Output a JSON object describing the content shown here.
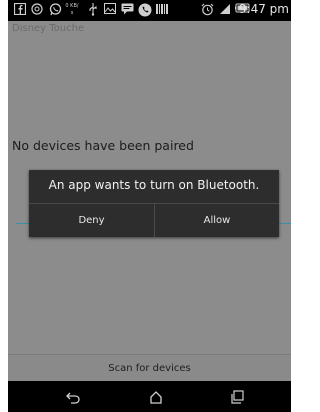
{
  "status_bar": {
    "time": "9:47 pm",
    "icons": [
      "facebook-icon",
      "instagram-icon",
      "whatsapp-icon",
      "data-speed-icon",
      "usb-icon",
      "gallery-icon",
      "message-icon",
      "call-icon",
      "barcode-icon",
      "alarm-icon",
      "signal-icon",
      "battery-icon"
    ],
    "data_speed": "0 KB/s"
  },
  "app": {
    "title": "Disney Touche",
    "empty_message": "No devices have been paired",
    "scan_button_label": "Scan for devices"
  },
  "dialog": {
    "message": "An app wants to turn on Bluetooth.",
    "deny_label": "Deny",
    "allow_label": "Allow"
  },
  "nav_bar": {
    "buttons": [
      "back-icon",
      "home-icon",
      "recents-icon"
    ]
  },
  "colors": {
    "accent_line": "#3c8fa8",
    "dialog_bg": "#2d2d2d",
    "app_bg": "#8c8c8c"
  }
}
